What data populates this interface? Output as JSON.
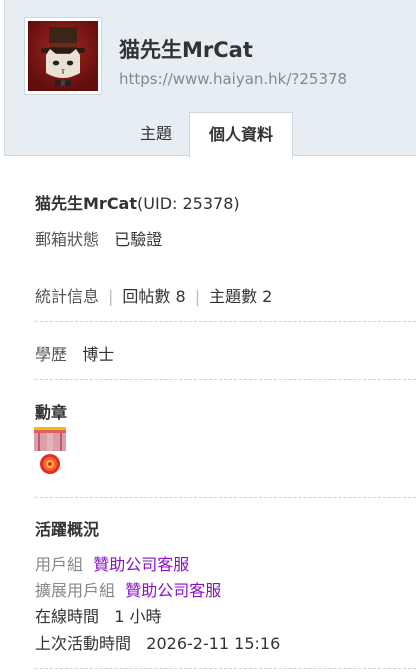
{
  "profile": {
    "username": "猫先生MrCat",
    "url": "https://www.haiyan.hk/?25378",
    "uid_text": "(UID: 25378)"
  },
  "tabs": [
    {
      "label": "主題",
      "active": false
    },
    {
      "label": "個人資料",
      "active": true
    }
  ],
  "info": {
    "email_label": "郵箱狀態",
    "email_value": "已驗證",
    "stats_label": "統計信息",
    "posts": "回帖數 8",
    "threads": "主題數 2",
    "education_label": "學歷",
    "education_value": "博士"
  },
  "medals": {
    "heading": "勳章",
    "items": [
      {
        "icon": "medal-icon"
      }
    ]
  },
  "activity": {
    "heading": "活躍概況",
    "group_label": "用戶組",
    "group_value": "贊助公司客服",
    "ext_group_label": "擴展用戶組",
    "ext_group_value": "贊助公司客服",
    "online_label": "在線時間",
    "online_value": "1 小時",
    "last_active_label": "上次活動時間",
    "last_active_value": "2026-2-11 15:16"
  },
  "colors": {
    "header_bg": "#e6eef4",
    "link": "#8a10c8"
  }
}
